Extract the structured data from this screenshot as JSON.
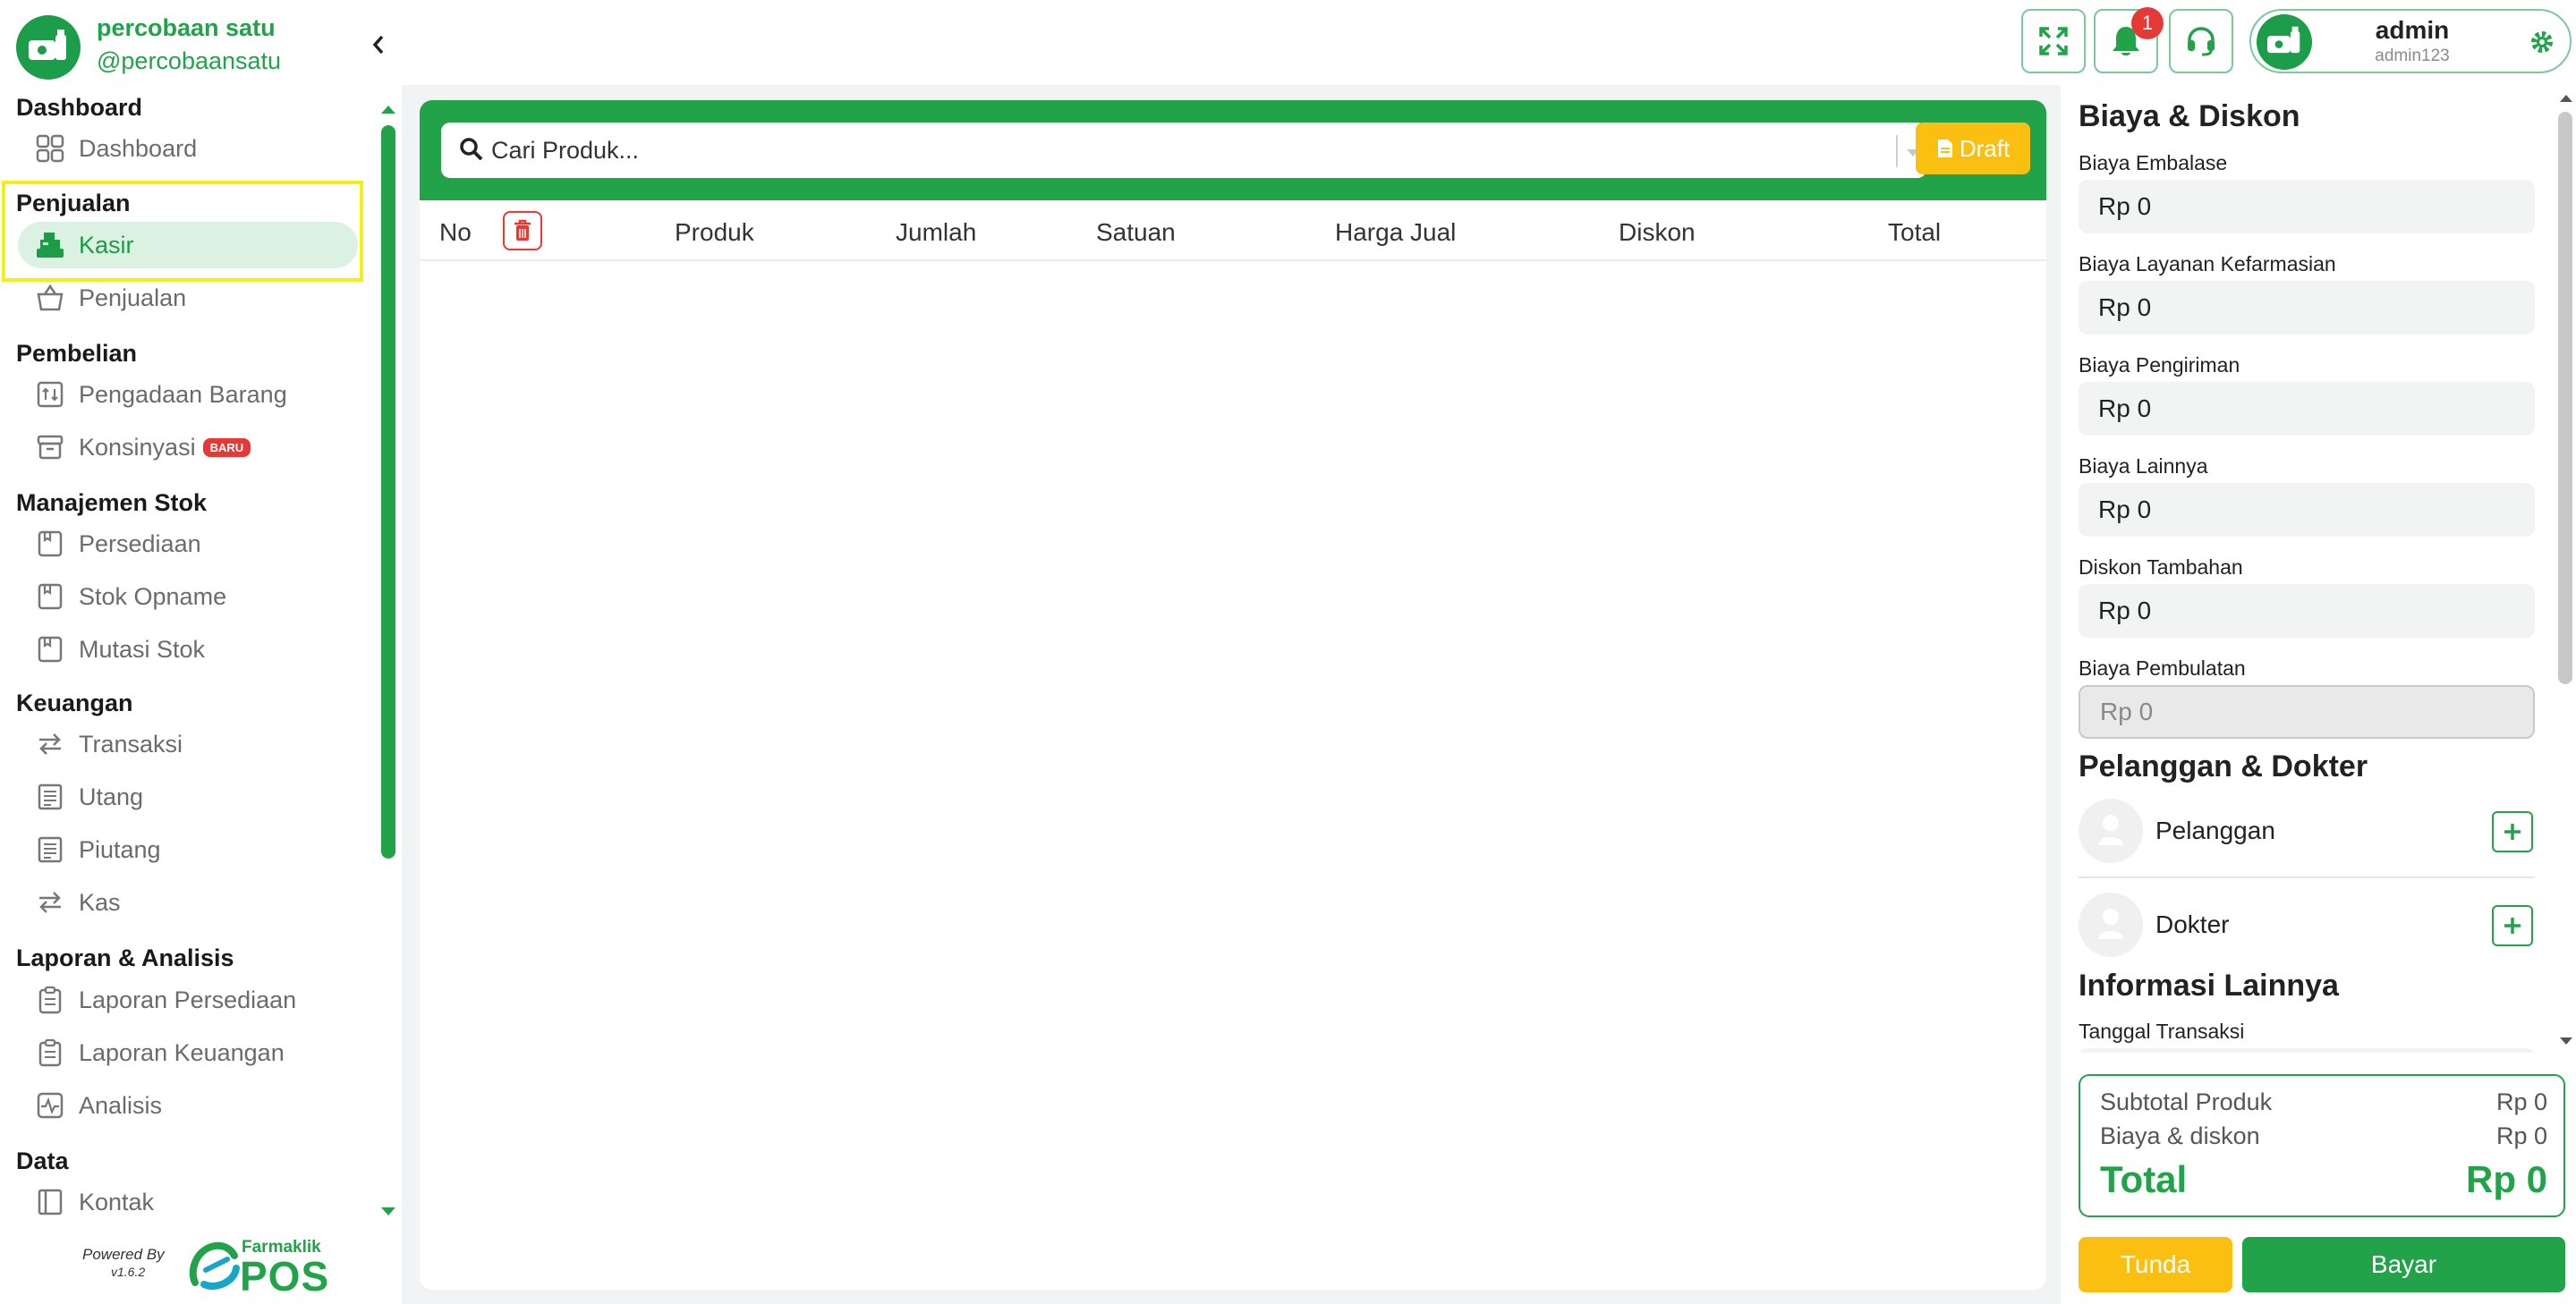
{
  "colors": {
    "brand_green": "#22a34a",
    "accent_yellow": "#fbbf12",
    "danger_red": "#e53935",
    "highlight": "#f4ee1a"
  },
  "brand": {
    "name": "percobaan satu",
    "handle": "@percobaansatu",
    "logo_icon": "pharmacy-logo-icon"
  },
  "sidebar": {
    "sections": [
      {
        "title": "Dashboard",
        "items": [
          {
            "label": "Dashboard",
            "icon": "grid-icon"
          }
        ]
      },
      {
        "title": "Penjualan",
        "items": [
          {
            "label": "Kasir",
            "icon": "cash-register-icon",
            "active": true
          },
          {
            "label": "Penjualan",
            "icon": "basket-icon"
          }
        ]
      },
      {
        "title": "Pembelian",
        "items": [
          {
            "label": "Pengadaan Barang",
            "icon": "procurement-icon"
          },
          {
            "label": "Konsinyasi",
            "icon": "archive-icon",
            "badge": "BARU"
          }
        ]
      },
      {
        "title": "Manajemen Stok",
        "items": [
          {
            "label": "Persediaan",
            "icon": "inventory-icon"
          },
          {
            "label": "Stok Opname",
            "icon": "stock-opname-icon"
          },
          {
            "label": "Mutasi Stok",
            "icon": "stock-mutation-icon"
          }
        ]
      },
      {
        "title": "Keuangan",
        "items": [
          {
            "label": "Transaksi",
            "icon": "transfer-icon"
          },
          {
            "label": "Utang",
            "icon": "ledger-icon"
          },
          {
            "label": "Piutang",
            "icon": "ledger-icon"
          },
          {
            "label": "Kas",
            "icon": "transfer-icon"
          }
        ]
      },
      {
        "title": "Laporan & Analisis",
        "items": [
          {
            "label": "Laporan Persediaan",
            "icon": "clipboard-icon"
          },
          {
            "label": "Laporan Keuangan",
            "icon": "clipboard-icon"
          },
          {
            "label": "Analisis",
            "icon": "activity-icon"
          }
        ]
      },
      {
        "title": "Data",
        "items": [
          {
            "label": "Kontak",
            "icon": "contact-book-icon"
          }
        ]
      }
    ],
    "powered_by": "Powered By",
    "version": "v1.6.2",
    "vendor_name": "Farmaklik",
    "vendor_product": "POS"
  },
  "topbar": {
    "notification_count": "1",
    "user": {
      "name": "admin",
      "id": "admin123"
    }
  },
  "cart": {
    "search_placeholder": "Cari Produk...",
    "draft_label": "Draft",
    "columns": [
      "No",
      "Produk",
      "Jumlah",
      "Satuan",
      "Harga Jual",
      "Diskon",
      "Total"
    ],
    "rows": []
  },
  "right_panel": {
    "fees_title": "Biaya & Diskon",
    "fees": [
      {
        "label": "Biaya Embalase",
        "value": "Rp 0"
      },
      {
        "label": "Biaya Layanan Kefarmasian",
        "value": "Rp 0"
      },
      {
        "label": "Biaya Pengiriman",
        "value": "Rp 0"
      },
      {
        "label": "Biaya Lainnya",
        "value": "Rp 0"
      },
      {
        "label": "Diskon Tambahan",
        "value": "Rp 0"
      },
      {
        "label": "Biaya Pembulatan",
        "value": "Rp 0",
        "disabled": true
      }
    ],
    "parties_title": "Pelanggan & Dokter",
    "customer_label": "Pelanggan",
    "doctor_label": "Dokter",
    "info_title": "Informasi Lainnya",
    "date_label": "Tanggal Transaksi"
  },
  "summary": {
    "subtotal_label": "Subtotal Produk",
    "subtotal_value": "Rp 0",
    "fees_label": "Biaya & diskon",
    "fees_value": "Rp 0",
    "total_label": "Total",
    "total_value": "Rp 0"
  },
  "actions": {
    "hold_label": "Tunda",
    "pay_label": "Bayar"
  }
}
